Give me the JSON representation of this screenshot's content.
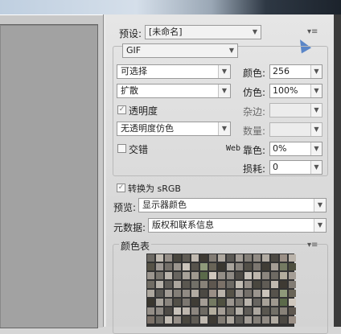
{
  "panel": {
    "preset_label": "预设:",
    "preset_value": "[未命名]",
    "format_value": "GIF",
    "reduction_value": "可选择",
    "dither_algo_value": "扩散",
    "transparency_label": "透明度",
    "transparency_checked": true,
    "transparency_dither_value": "无透明度仿色",
    "interlaced_label": "交错",
    "interlaced_checked": false,
    "colors_label": "颜色:",
    "colors_value": "256",
    "dither_label": "仿色:",
    "dither_value": "100%",
    "matte_label": "杂边:",
    "matte_value": "",
    "amount_label": "数量:",
    "amount_value": "",
    "web_snap_prefix": "Web",
    "web_snap_label": "靠色:",
    "web_snap_value": "0%",
    "lossy_label": "损耗:",
    "lossy_value": "0",
    "convert_srgb_label": "转换为 sRGB",
    "convert_srgb_checked": true,
    "preview_label": "预览:",
    "preview_value": "显示器颜色",
    "metadata_label": "元数据:",
    "metadata_value": "版权和联系信息",
    "color_table_label": "颜色表"
  },
  "icons": {
    "panel_menu": "panel-menu-icon",
    "dropdown": "chevron-down-icon"
  },
  "swatch_colors": [
    "#6d6a64",
    "#8f8a84",
    "#a9a49c",
    "#5c5a55",
    "#b5b0a8",
    "#7a766f",
    "#9e9893",
    "#c2bcb3",
    "#4e4b46",
    "#8a857e",
    "#a39d96",
    "#5f5c57",
    "#b9b3ab",
    "#75706a",
    "#968f88",
    "#c7c1b9",
    "#535048",
    "#847f78",
    "#aca69e",
    "#686560",
    "#9b958e",
    "#4a473f",
    "#bdb6ad",
    "#7c7770",
    "#918b84",
    "#5a5750",
    "#a7a198",
    "#cbc4bb",
    "#605c55",
    "#8c867f",
    "#403d36",
    "#b1aba2",
    "#727068",
    "#9f998f",
    "#57534c",
    "#c0b9b0",
    "#6e6a63",
    "#a49d95",
    "#4c4943",
    "#888279",
    "#5b6a4a",
    "#8f9a7a",
    "#3e3a33",
    "#b3ad9e",
    "#747a62",
    "#9a8f86",
    "#5e574f",
    "#cfc7bd",
    "#696457",
    "#827c74",
    "#a59e96",
    "#4f5040",
    "#bab3aa",
    "#7b7168",
    "#948e87",
    "#3a372f",
    "#aea89f",
    "#706c64",
    "#9c968f",
    "#565247"
  ]
}
